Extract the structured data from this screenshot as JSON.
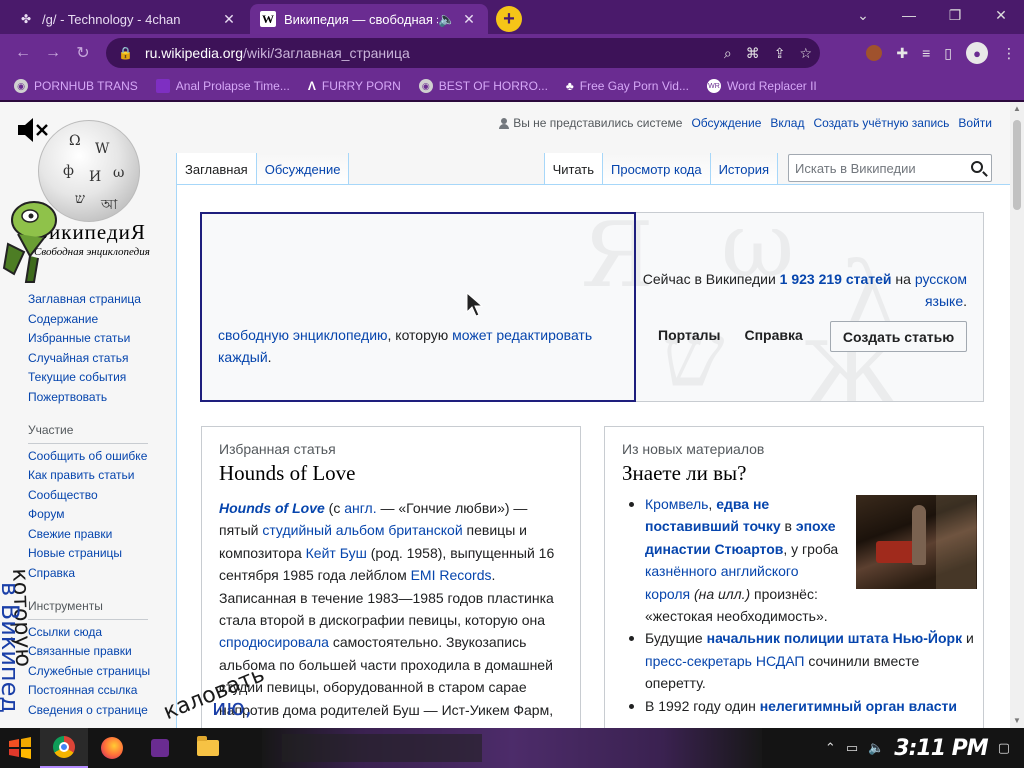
{
  "browser": {
    "tabs": [
      {
        "title": "/g/ - Technology - 4chan",
        "favicon": "4chan-clover-icon"
      },
      {
        "title": "Википедия — свободная э",
        "favicon": "wikipedia-w-icon",
        "active": true
      }
    ],
    "newtab": "+",
    "url": {
      "host": "ru.wikipedia.org",
      "path": "/wiki/Заглавная_страница"
    },
    "bookmarks": [
      "PORNHUB TRANS",
      "Anal Prolapse Time...",
      "FURRY PORN",
      "BEST OF HORRO...",
      "Free Gay Porn Vid...",
      "Word Replacer II"
    ]
  },
  "wiki": {
    "personal": {
      "not_logged_in": "Вы не представились системе",
      "talk": "Обсуждение",
      "contributions": "Вклад",
      "create_account": "Создать учётную запись",
      "login": "Войти"
    },
    "logo": {
      "wordmark": "ВикипедиЯ",
      "tagline": "Свободная энциклопедия"
    },
    "nav_main": [
      "Заглавная страница",
      "Содержание",
      "Избранные статьи",
      "Случайная статья",
      "Текущие события",
      "Пожертвовать"
    ],
    "nav_participation_heading": "Участие",
    "nav_participation": [
      "Сообщить об ошибке",
      "Как править статьи",
      "Сообщество",
      "Форум",
      "Свежие правки",
      "Новые страницы",
      "Справка"
    ],
    "nav_tools_heading": "Инструменты",
    "nav_tools": [
      "Ссылки сюда",
      "Связанные правки",
      "Служебные страницы",
      "Постоянная ссылка",
      "Сведения о странице"
    ],
    "tabs_left": [
      "Заглавная",
      "Обсуждение"
    ],
    "tabs_right": [
      "Читать",
      "Просмотр кода",
      "История"
    ],
    "search_placeholder": "Искать в Википедии",
    "banner": {
      "link1": "свободную энциклопедию",
      "text1": ", которую ",
      "link2": "может редактировать каждый",
      "text2": ".",
      "count_pre": "Сейчас в Википедии ",
      "count_link": "1 923 219 статей",
      "count_mid": " на ",
      "count_lang": "русском языке",
      "count_post": ".",
      "portals": "Порталы",
      "help": "Справка",
      "create": "Создать статью"
    },
    "featured": {
      "kicker": "Избранная статья",
      "heading": "Hounds of Love",
      "title_link": "Hounds of Love",
      "p1": " (с ",
      "eng": "англ.",
      "p2": " — «Гончие любви») — пятый ",
      "studio": "студийный",
      "album": "альбом",
      "british": "британской",
      "p3": " певицы и композитора ",
      "kate": "Кейт Буш",
      "p4": " (род. 1958), выпущенный 16 сентября 1985 года лейблом ",
      "emi": "EMI Records",
      "p5": ". Записанная в течение 1983—1985 годов пластинка стала второй в дискографии певицы, которую она ",
      "produced": "спродюсировала",
      "p6": " самостоятельно. Звукозапись альбома по большей части проходила в домашней студии певицы, оборудованной в старом сарае напротив дома родителей Буш — Ист-Уикем Фарм,"
    },
    "dyk": {
      "kicker": "Из новых материалов",
      "heading": "Знаете ли вы?",
      "item1": {
        "cromwell": "Кромвель",
        "comma": ", ",
        "bold1": "едва не поставивший точку",
        "in": " в ",
        "bold2": "эпохе династии Стюартов",
        "mid": ", у гроба ",
        "executed": "казнённого английского короля",
        "caption": " (на илл.)",
        "end": " произнёс: «жестокая необходимость»."
      },
      "item2": {
        "pre": "Будущие ",
        "bold": "начальник полиции штата Нью-Йорк",
        "and": " и ",
        "press": "пресс-секретарь НСДАП",
        "end": " сочинили вместе оперетту."
      },
      "item3": {
        "pre": "В 1992 году один ",
        "bold": "нелегитимный орган власти"
      }
    }
  },
  "overlay": {
    "scribble1": "которую",
    "scribble2": "в Википед",
    "scribble3": "каловать",
    "scribble4": "ию,"
  },
  "taskbar": {
    "clock": "3:11 PM"
  }
}
